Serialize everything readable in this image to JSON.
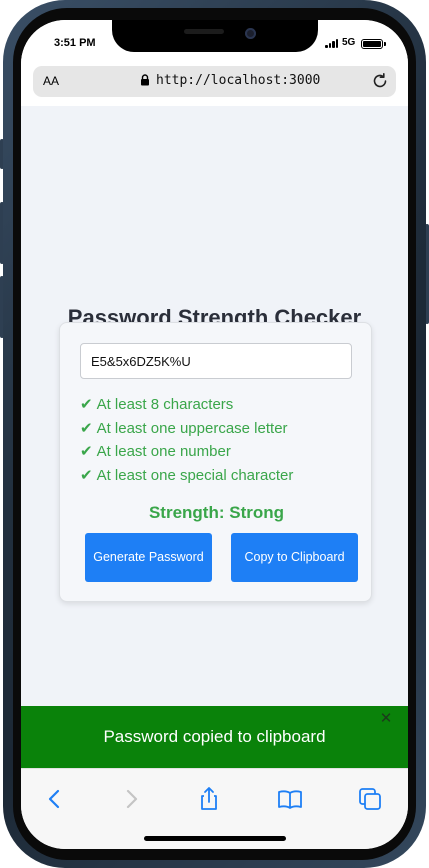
{
  "status_bar": {
    "time": "3:51 PM",
    "network": "5G"
  },
  "browser": {
    "aa_label": "AA",
    "url": "http://localhost:3000"
  },
  "app": {
    "title": "Password Strength Checker",
    "password_value": "E5&5x6DZ5K%U",
    "check_mark": "✔",
    "criteria": [
      "At least 8 characters",
      "At least one uppercase letter",
      "At least one number",
      "At least one special character"
    ],
    "strength_label": "Strength: Strong",
    "generate_button": "Generate Password",
    "copy_button": "Copy to Clipboard"
  },
  "toast": {
    "message": "Password copied to clipboard",
    "close_glyph": "✕",
    "color": "#0a820a"
  },
  "colors": {
    "accent": "#1e7ff5",
    "success": "#3aa64a"
  },
  "toolbar": {
    "icons": [
      "back-icon",
      "forward-icon",
      "share-icon",
      "bookmarks-icon",
      "tabs-icon"
    ]
  }
}
